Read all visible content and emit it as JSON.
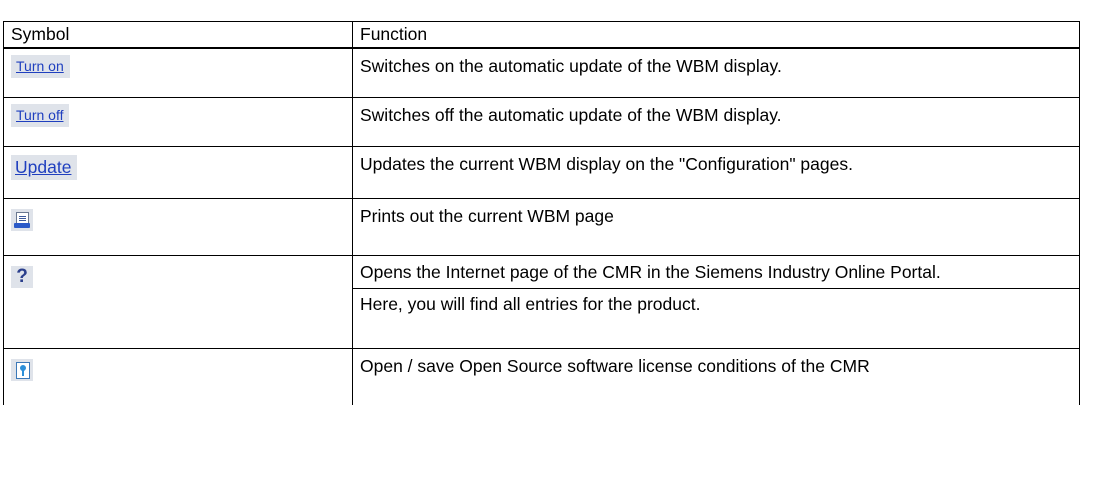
{
  "table": {
    "headers": {
      "symbol": "Symbol",
      "function": "Function"
    },
    "rows": [
      {
        "symbol_type": "text-button",
        "symbol_label": "Turn on",
        "function": "Switches on the automatic update of the WBM display."
      },
      {
        "symbol_type": "text-button",
        "symbol_label": "Turn off",
        "function": "Switches off the automatic update of the WBM display."
      },
      {
        "symbol_type": "text-button",
        "symbol_label": "Update",
        "function": "Updates the current WBM display on the \"Configuration\" pages."
      },
      {
        "symbol_type": "icon",
        "icon": "printer-icon",
        "function": "Prints out the current WBM page"
      },
      {
        "symbol_type": "icon",
        "icon": "help-icon",
        "icon_glyph": "?",
        "function": "Opens the Internet page of the CMR in the Siemens Industry Online Portal.",
        "function_extra": "Here, you will find all entries for the product."
      },
      {
        "symbol_type": "icon",
        "icon": "license-icon",
        "function": "Open / save Open Source software license conditions of the CMR"
      }
    ]
  },
  "colors": {
    "button_bg": "#dfe3ea",
    "link_text": "#1f3fbf",
    "help_glyph": "#2b3f8c",
    "printer_blue": "#2b5ac8",
    "license_blue": "#2d8fd9"
  }
}
